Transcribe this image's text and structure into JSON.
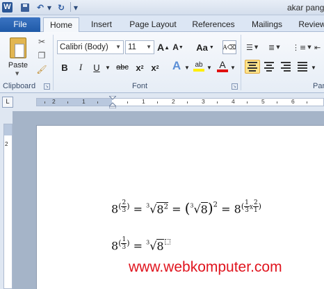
{
  "app": {
    "icon_letter": "W",
    "document_title": "akar pang"
  },
  "tabs": [
    {
      "label": "File"
    },
    {
      "label": "Home"
    },
    {
      "label": "Insert"
    },
    {
      "label": "Page Layout"
    },
    {
      "label": "References"
    },
    {
      "label": "Mailings"
    },
    {
      "label": "Review"
    }
  ],
  "clipboard": {
    "paste_label": "Paste",
    "group_label": "Clipboard"
  },
  "font": {
    "font_name": "Calibri (Body)",
    "font_size": "11",
    "grow": "A",
    "shrink": "A",
    "change_case": "Aa",
    "bold": "B",
    "italic": "I",
    "underline": "U",
    "strike": "abc",
    "subscript": "x",
    "subscript_sub": "2",
    "superscript": "x",
    "superscript_sup": "2",
    "text_effect": "A",
    "highlight": "ab",
    "font_color": "A",
    "group_label": "Font"
  },
  "paragraph": {
    "group_label": "Para"
  },
  "ruler": {
    "corner": "L",
    "labels": [
      "2",
      "1",
      "1",
      "2",
      "3",
      "4",
      "5",
      "6"
    ]
  },
  "vertical_ruler": {
    "label": "2"
  },
  "equations": {
    "eq1": {
      "base": "8",
      "exp_num": "2",
      "exp_den": "3",
      "equals": "=",
      "root_index": "3",
      "radical": "√",
      "radicand": "8",
      "radicand_exp": "2",
      "paren_open": "(",
      "paren_close": ")",
      "outer_exp": "2",
      "final_base": "8",
      "f1_num": "1",
      "f1_den": "3",
      "times": "x",
      "f2_num": "2",
      "f2_den": "1"
    },
    "eq2": {
      "base": "8",
      "exp_num": "1",
      "exp_den": "3",
      "equals": "=",
      "root_index": "3",
      "radical": "√",
      "radicand": "8"
    }
  },
  "watermark": "www.webkomputer.com",
  "colors": {
    "file_tab": "#2b5fad",
    "watermark": "#e0141e",
    "active_align": "#fde38a"
  }
}
